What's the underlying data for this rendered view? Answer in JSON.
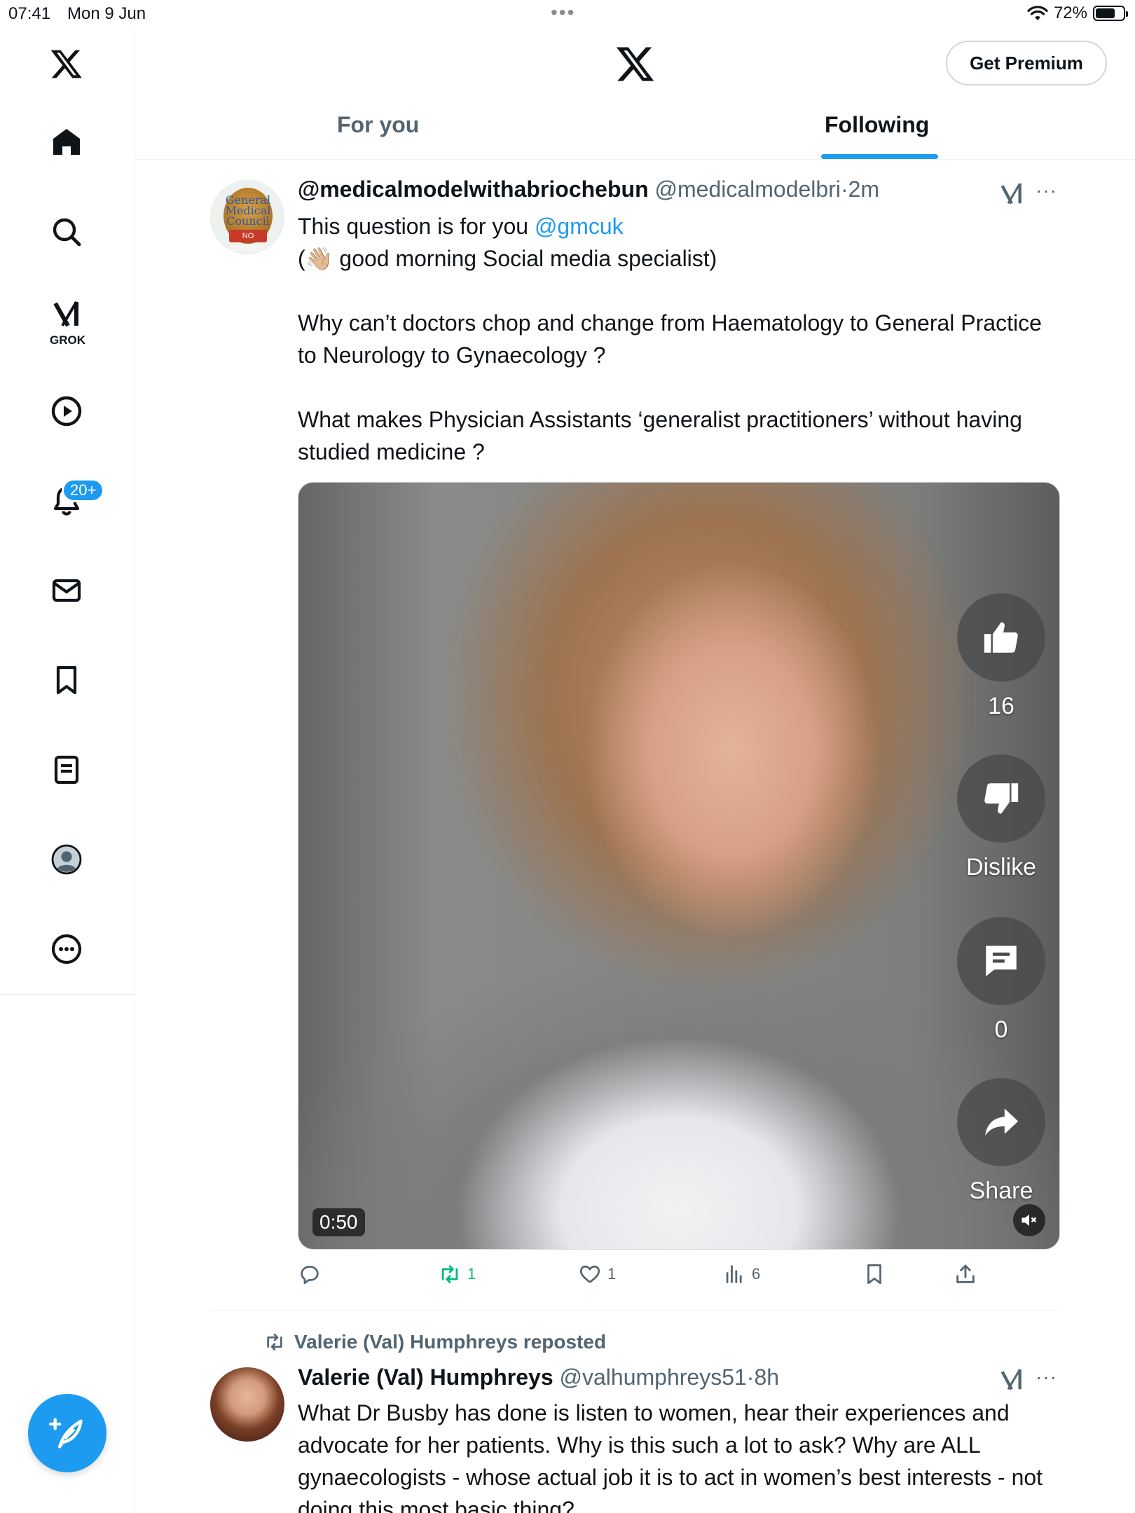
{
  "status_bar": {
    "time": "07:41",
    "date": "Mon 9 Jun",
    "battery": "72%",
    "battery_level": 0.72
  },
  "rail": {
    "grok_label": "GROK",
    "notification_badge": "20+",
    "icons": [
      "x-logo-icon",
      "home-icon",
      "search-icon",
      "grok-icon",
      "video-icon",
      "bell-icon",
      "mail-icon",
      "bookmark-icon",
      "list-icon",
      "profile-icon",
      "more-icon",
      "compose-icon"
    ]
  },
  "header": {
    "premium_label": "Get Premium",
    "tabs": [
      {
        "label": "For you",
        "active": false
      },
      {
        "label": "Following",
        "active": true
      }
    ]
  },
  "tweet1": {
    "name": "@medicalmodelwithabriochebun",
    "handle": "@medicalmodelbri",
    "separator": "·",
    "time": "2m",
    "avatar_text": "General Medical Council",
    "avatar_tag": "NO CONSEQUENCES",
    "line1_prefix": "This question is for you ",
    "mention": "@gmcuk",
    "line2": "(👋🏼 good morning Social media specialist)",
    "para2": "Why can’t doctors chop and change from Haematology to General Practice to Neurology to Gynaecology ?",
    "para3": "What makes Physician Assistants ‘generalist practitioners’ without having studied medicine ?",
    "video": {
      "duration": "0:50",
      "like_count": "16",
      "dislike_label": "Dislike",
      "comment_count": "0",
      "share_label": "Share"
    },
    "actions": {
      "reposts": "1",
      "likes": "1",
      "views": "6"
    }
  },
  "tweet2": {
    "repost_line": "Valerie (Val) Humphreys reposted",
    "name": "Valerie (Val) Humphreys",
    "handle": "@valhumphreys51",
    "separator": "·",
    "time": "8h",
    "text": "What Dr Busby has done is listen to women, hear their experiences and advocate for her patients. Why is this such a lot to ask? Why are ALL gynaecologists - whose actual job it is to act in women’s best interests - not doing this most basic thing?"
  },
  "colors": {
    "accent": "#1d9bf0",
    "retweet": "#00ba7c",
    "secondary_text": "#536471",
    "text": "#0f1419"
  }
}
